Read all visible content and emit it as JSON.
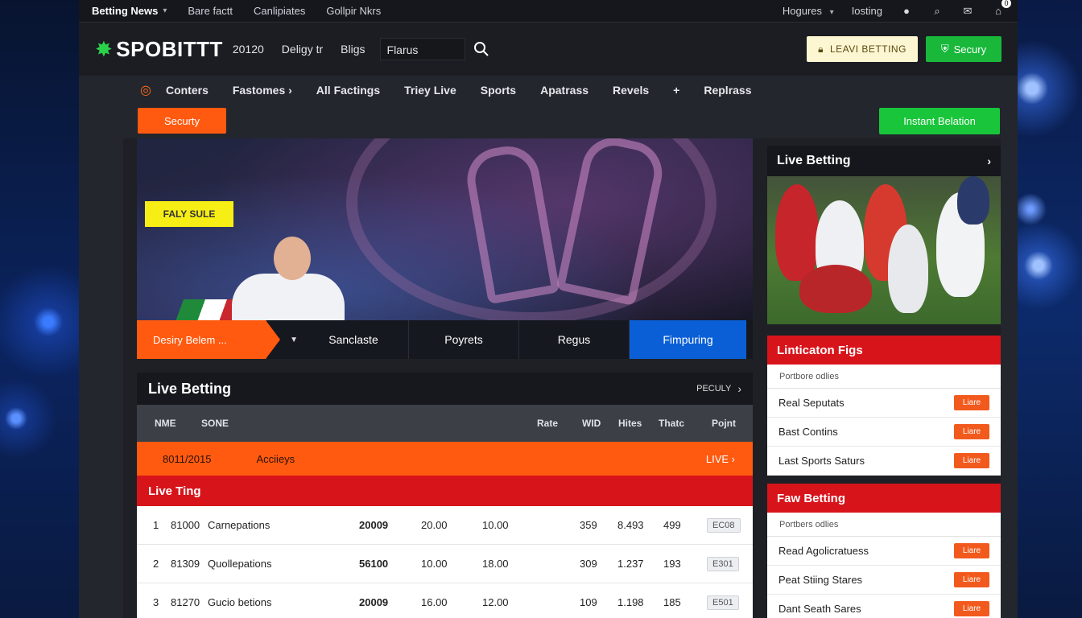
{
  "topbar": {
    "brand": "Betting News",
    "links": [
      "Bare factt",
      "Canlipiates",
      "Gollpir Nkrs"
    ],
    "right_links": [
      "Hogures",
      "Iosting"
    ],
    "cart_count": "0"
  },
  "header": {
    "logo": "SPOBITTT",
    "links": [
      "20120",
      "Deligy tr",
      "Bligs"
    ],
    "search_value": "Flarus",
    "btn_primary": "LEAVI BETTING",
    "btn_secondary": "Secury"
  },
  "nav": {
    "items": [
      "Conters",
      "Fastomes ›",
      "All Factings",
      "Triey Live",
      "Sports",
      "Apatrass",
      "Revels",
      "+",
      "Replrass"
    ]
  },
  "subbar": {
    "left_button": "Securty",
    "right_button": "Instant Belation"
  },
  "hero": {
    "badge": "FALY SULE",
    "tabs": [
      "Desiry Belem ...",
      "Sanclaste",
      "Poyrets",
      "Regus",
      "Fimpuring"
    ]
  },
  "live": {
    "title": "Live Betting",
    "more": "PECULY",
    "columns": [
      "NME",
      "SONE",
      "Rate",
      "WID",
      "Hites",
      "Thatc",
      "Pojnt"
    ],
    "featured": {
      "date": "8011/2015",
      "name": "Acciieys",
      "status": "LIVE ›"
    },
    "section_title": "Live Ting",
    "rows": [
      {
        "num": "1",
        "code": "81000",
        "name": "Carnepations",
        "a": "20009",
        "b": "20.00",
        "c": "10.00",
        "d": "359",
        "e": "8.493",
        "f": "499",
        "tag": "EC08"
      },
      {
        "num": "2",
        "code": "81309",
        "name": "Quollepations",
        "a": "56100",
        "b": "10.00",
        "c": "18.00",
        "d": "309",
        "e": "1.237",
        "f": "193",
        "tag": "E301"
      },
      {
        "num": "3",
        "code": "81270",
        "name": "Gucio betions",
        "a": "20009",
        "b": "16.00",
        "c": "12.00",
        "d": "109",
        "e": "1.198",
        "f": "185",
        "tag": "E501"
      }
    ]
  },
  "side": {
    "live_title": "Live Betting",
    "panel1": {
      "title": "Linticaton Figs",
      "sub": "Portbore odlies",
      "rows": [
        "Real Seputats",
        "Bast Contins",
        "Last Sports Saturs"
      ],
      "btn": "Liare"
    },
    "panel2": {
      "title": "Faw Betting",
      "sub": "Portbers odlies",
      "rows": [
        "Read Agolicratuess",
        "Peat Stiing Stares",
        "Dant Seath Sares"
      ],
      "btn": "Liare"
    }
  },
  "colors": {
    "orange": "#ff5a10",
    "red": "#d8141b",
    "green": "#19c53a",
    "blue": "#0a5fd6",
    "yellow": "#f7ee15"
  }
}
